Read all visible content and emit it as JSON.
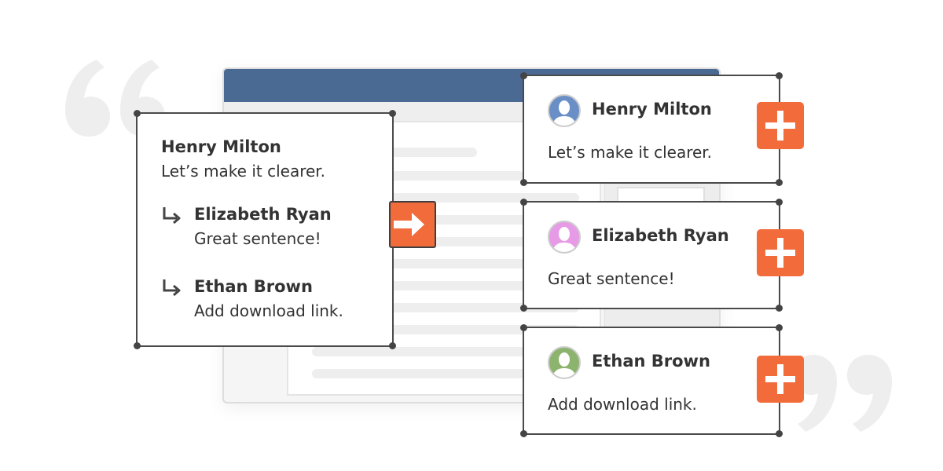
{
  "colors": {
    "accent": "#f26b3a",
    "titlebar": "#4a6a93",
    "frame": "#4a4a4a",
    "quote": "#eeeeee"
  },
  "thread": {
    "author": "Henry Milton",
    "text": "Let’s make it clearer.",
    "replies": [
      {
        "author": "Elizabeth Ryan",
        "text": "Great sentence!"
      },
      {
        "author": "Ethan Brown",
        "text": "Add download link."
      }
    ]
  },
  "comments": [
    {
      "author": "Henry Milton",
      "text": "Let’s make it clearer.",
      "avatar_icon": "user-avatar-icon",
      "avatar_color": "#6a8fc7"
    },
    {
      "author": "Elizabeth Ryan",
      "text": "Great sentence!",
      "avatar_icon": "user-avatar-icon",
      "avatar_color": "#e79be6"
    },
    {
      "author": "Ethan Brown",
      "text": "Add download link.",
      "avatar_icon": "user-avatar-icon",
      "avatar_color": "#8db46e"
    }
  ],
  "icons": {
    "open_quote": "open-quote-icon",
    "close_quote": "close-quote-icon",
    "reply": "reply-arrow-icon",
    "expand": "arrow-right-icon",
    "add": "plus-icon"
  }
}
